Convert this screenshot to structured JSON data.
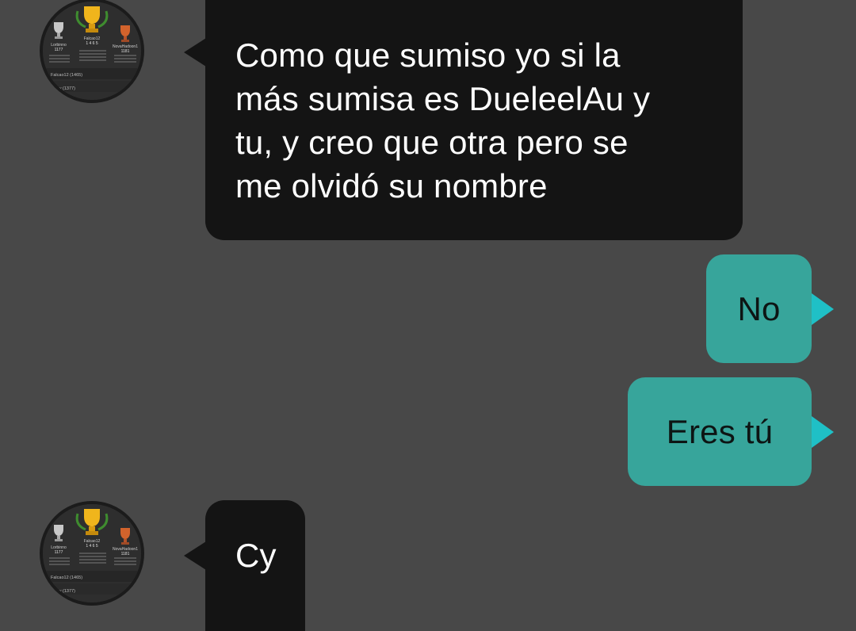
{
  "messages": [
    {
      "direction": "incoming",
      "text": "Como que sumiso yo si la\nmás sumisa es DueleelAu y\ntu, y creo que otra pero se\nme olvidó su nombre"
    },
    {
      "direction": "outgoing",
      "text": "No"
    },
    {
      "direction": "outgoing",
      "text": "Eres tú"
    },
    {
      "direction": "incoming",
      "text": "Cy"
    }
  ],
  "colors": {
    "background": "#484848",
    "incoming_bubble": "#141414",
    "outgoing_bubble": "#37a59b",
    "outgoing_tail": "#1fc0c6"
  },
  "avatar": {
    "icon": "leaderboard-trophies-avatar",
    "names": [
      "Lorbinno",
      "Falcao12",
      "NovaHadoon1"
    ],
    "scores": [
      "1177",
      "1 4 6 5",
      "1181"
    ],
    "rows": [
      "Falcao12 (1465)",
      "vy (1377)"
    ]
  }
}
